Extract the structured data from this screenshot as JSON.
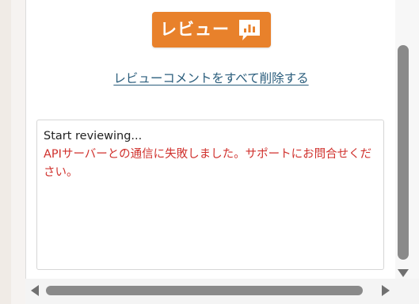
{
  "review_button": {
    "label": "レビュー",
    "icon": "bar-chart-speech-bubble-icon",
    "color": "#e8812b"
  },
  "delete_link": {
    "label": "レビューコメントをすべて削除する",
    "color": "#2a5d7c"
  },
  "log": {
    "status_line": "Start reviewing...",
    "error_line": "APIサーバーとの通信に失敗しました。サポートにお問合せください。",
    "error_color": "#d0312d"
  },
  "scrollbars": {
    "vertical_down_icon": "triangle-down-icon",
    "horizontal_left_icon": "triangle-left-icon",
    "horizontal_right_icon": "triangle-right-icon"
  }
}
